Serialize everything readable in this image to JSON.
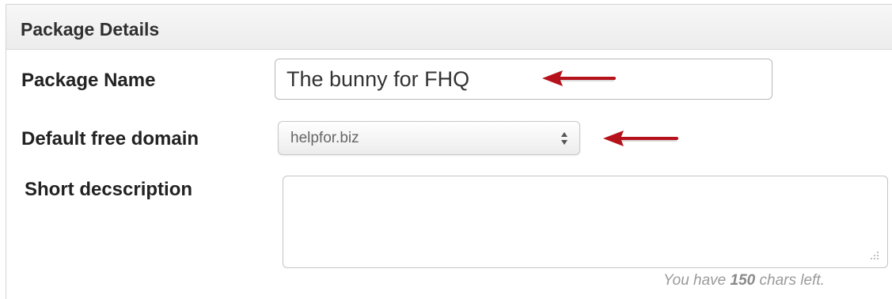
{
  "panel": {
    "title": "Package Details"
  },
  "form": {
    "package_name": {
      "label": "Package Name",
      "value": "The bunny for FHQ"
    },
    "default_domain": {
      "label": "Default free domain",
      "selected": "helpfor.biz"
    },
    "short_description": {
      "label": "Short decscription",
      "value": "",
      "counter_prefix": "You have",
      "counter_value": "150",
      "counter_suffix": "chars left."
    }
  },
  "colors": {
    "arrow": "#b5121b"
  },
  "icons": {
    "select_caret": "up-down-caret-icon",
    "resize_grip": "resize-grip-icon",
    "annotation_arrow": "left-arrow-icon"
  }
}
